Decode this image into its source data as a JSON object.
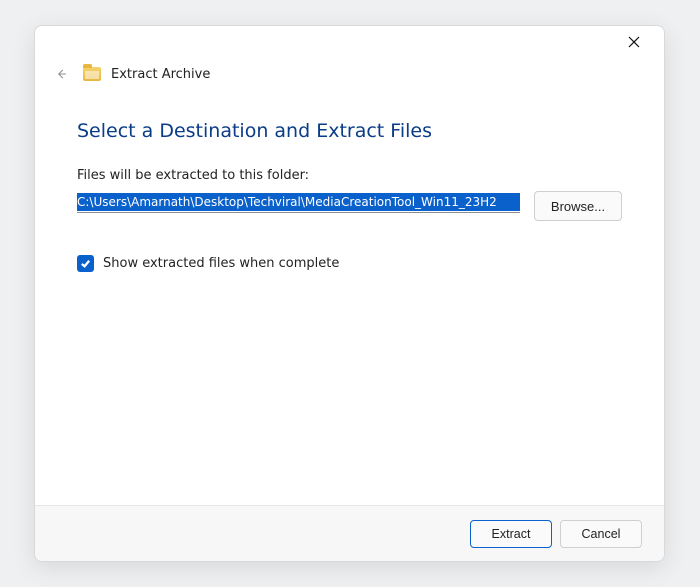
{
  "dialog": {
    "title": "Extract Archive",
    "heading": "Select a Destination and Extract Files",
    "label": "Files will be extracted to this folder:",
    "path": "C:\\Users\\Amarnath\\Desktop\\Techviral\\MediaCreationTool_Win11_23H2",
    "browse": "Browse...",
    "checkbox_label": "Show extracted files when complete",
    "extract": "Extract",
    "cancel": "Cancel"
  }
}
